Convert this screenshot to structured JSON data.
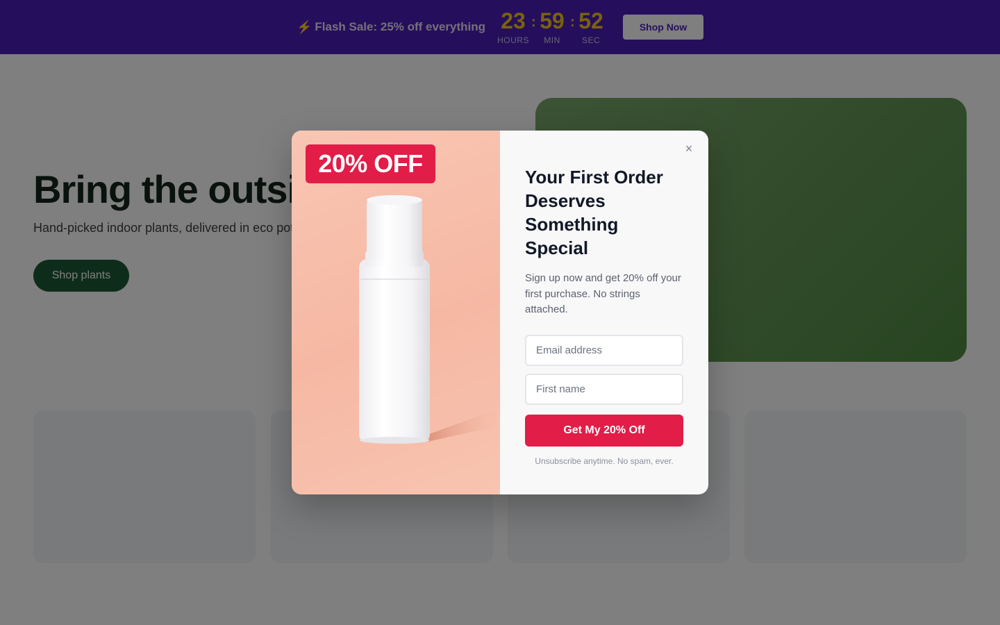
{
  "topbar": {
    "bolt_icon": "lightning-bolt-icon",
    "sale_text": "Flash Sale: 25% off everything",
    "countdown": {
      "hours": "23",
      "hours_label": "HOURS",
      "minutes": "59",
      "minutes_label": "MIN",
      "seconds": "52",
      "seconds_label": "SEC",
      "separator": ":"
    },
    "shop_now_label": "Shop Now"
  },
  "hero": {
    "title": "Bring the outside in",
    "subtitle": "Hand-picked indoor plants, delivered in eco pots",
    "cta_label": "Shop plants"
  },
  "modal": {
    "badge": "20% OFF",
    "close_icon": "close-icon",
    "close_glyph": "×",
    "title": "Your First Order Deserves Something Special",
    "description": "Sign up now and get 20% off your first purchase. No strings attached.",
    "email_placeholder": "Email address",
    "name_placeholder": "First name",
    "cta_label": "Get My 20% Off",
    "fineprint": "Unsubscribe anytime. No spam, ever."
  },
  "colors": {
    "topbar_bg": "#4a1fb8",
    "countdown_accent": "#f5c518",
    "brand_red": "#e11d48",
    "hero_green": "#1a5a34"
  }
}
